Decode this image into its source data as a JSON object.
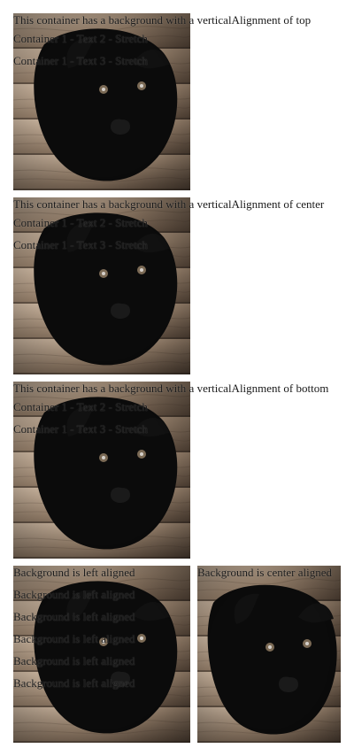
{
  "sections": [
    {
      "title": "This container has a background with a verticalAlignment of top",
      "items": [
        "Container 1 - Text 2 - Stretch",
        "Container 1 - Text 3 - Stretch"
      ]
    },
    {
      "title": "This container has a background with a verticalAlignment of center",
      "items": [
        "Container 1 - Text 2 - Stretch",
        "Container 1 - Text 3 - Stretch"
      ]
    },
    {
      "title": "This container has a background with a verticalAlignment of bottom",
      "items": [
        "Container 1 - Text 2 - Stretch",
        "Container 1 - Text 3 - Stretch"
      ]
    }
  ],
  "bottom_row": {
    "left_label": "Background is left aligned",
    "left_repeat": [
      "Background is left aligned",
      "Background is left aligned",
      "Background is left aligned",
      "Background is left aligned",
      "Background is left aligned",
      "Background is left aligned"
    ],
    "center_label": "Background is center aligned"
  },
  "colors": {
    "text": "#1a1a1a",
    "wood_dark": "#5b4a3a",
    "wood_light": "#b8a48d",
    "dog": "#0b0b0b"
  }
}
